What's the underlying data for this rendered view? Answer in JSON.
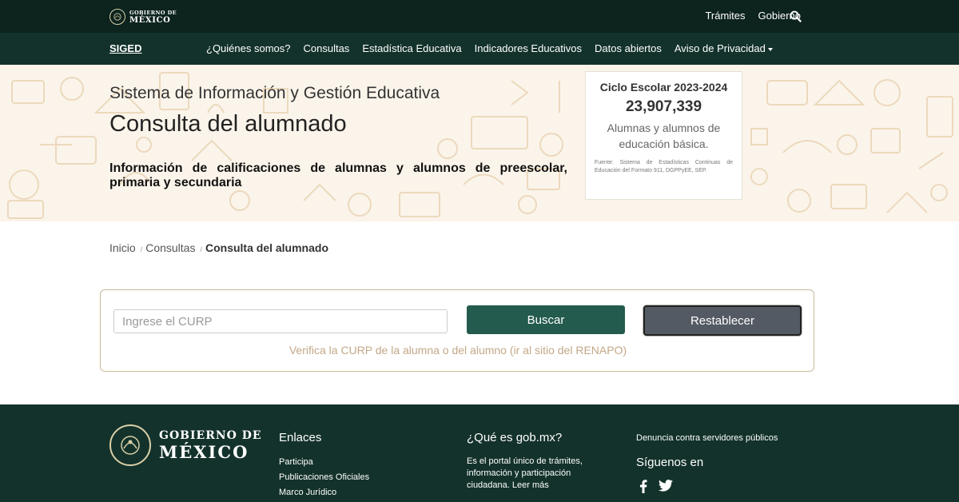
{
  "header": {
    "logo_line1": "GOBIERNO DE",
    "logo_line2": "MÉXICO",
    "links": [
      "Trámites",
      "Gobierno"
    ]
  },
  "nav": {
    "brand": "SIGED",
    "items": [
      "¿Quiénes somos?",
      "Consultas",
      "Estadística Educativa",
      "Indicadores Educativos",
      "Datos abiertos",
      "Aviso de Privacidad"
    ]
  },
  "hero": {
    "subtitle": "Sistema de Información y Gestión Educativa",
    "title": "Consulta del alumnado",
    "description": "Información de calificaciones de alumnas y alumnos de preescolar, primaria y secundaria"
  },
  "stat_card": {
    "cycle": "Ciclo Escolar 2023-2024",
    "number": "23,907,339",
    "label": "Alumnas y alumnos de educación básica.",
    "source": "Fuente: Sistema de Estadísticas Continuas de Educación del Formato 911, DGPPyEE, SEP."
  },
  "breadcrumb": {
    "home": "Inicio",
    "section": "Consultas",
    "current": "Consulta del alumnado"
  },
  "form": {
    "curp_placeholder": "Ingrese el CURP",
    "curp_value": "",
    "search_label": "Buscar",
    "reset_label": "Restablecer",
    "verify_text": "Verifica la CURP de la alumna o del alumno (ir al sitio del RENAPO)"
  },
  "footer": {
    "logo_line1": "GOBIERNO DE",
    "logo_line2": "MÉXICO",
    "links_title": "Enlaces",
    "links": [
      "Participa",
      "Publicaciones Oficiales",
      "Marco Jurídico"
    ],
    "what_title": "¿Qué es gob.mx?",
    "what_text": "Es el portal único de trámites, información y participación ciudadana. Leer más",
    "denuncia": "Denuncia contra servidores públicos",
    "follow": "Síguenos en"
  },
  "icons": {
    "search": "search-icon",
    "facebook": "facebook-icon",
    "twitter": "twitter-icon",
    "seal": "national-seal-icon"
  },
  "colors": {
    "topbar": "#0c231e",
    "navbar": "#13322b",
    "primary_button": "#235b4e",
    "reset_button": "#545a63",
    "hero_bg": "#fbf4ea",
    "accent_text": "#c3a887"
  }
}
